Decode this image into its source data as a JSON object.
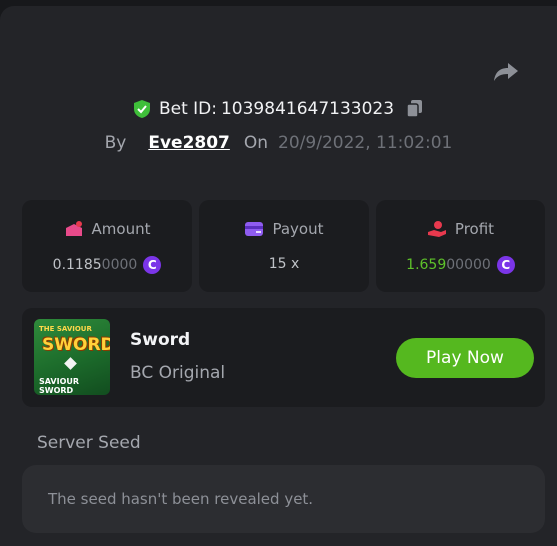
{
  "bet": {
    "id_label": "Bet ID:",
    "id_value": "1039841647133023",
    "by_label": "By",
    "username": "Eve2807",
    "on_label": "On",
    "datetime": "20/9/2022, 11:02:01"
  },
  "stats": {
    "amount": {
      "label": "Amount",
      "value_main": "0.1185",
      "value_dim": "0000",
      "coin": "C"
    },
    "payout": {
      "label": "Payout",
      "value": "15 x"
    },
    "profit": {
      "label": "Profit",
      "value_main": "1.659",
      "value_dim": "00000",
      "coin": "C"
    }
  },
  "game": {
    "thumb_top": "THE SAVIOUR",
    "thumb_title": "SWORD",
    "thumb_caption_1": "SAVIOUR",
    "thumb_caption_2": "SWORD",
    "name": "Sword",
    "provider": "BC Original",
    "play_label": "Play Now"
  },
  "server_seed": {
    "label": "Server Seed",
    "message": "The seed hasn't been revealed yet."
  },
  "colors": {
    "accent_green": "#55b81f",
    "coin_purple": "#7b35e8",
    "profit_green": "#5ec22a",
    "icon_red": "#e8394e",
    "icon_pink": "#e84a8a"
  },
  "icons": [
    "share-icon",
    "shield-check-icon",
    "copy-icon",
    "amount-icon",
    "payout-icon",
    "profit-icon",
    "coin-icon"
  ]
}
